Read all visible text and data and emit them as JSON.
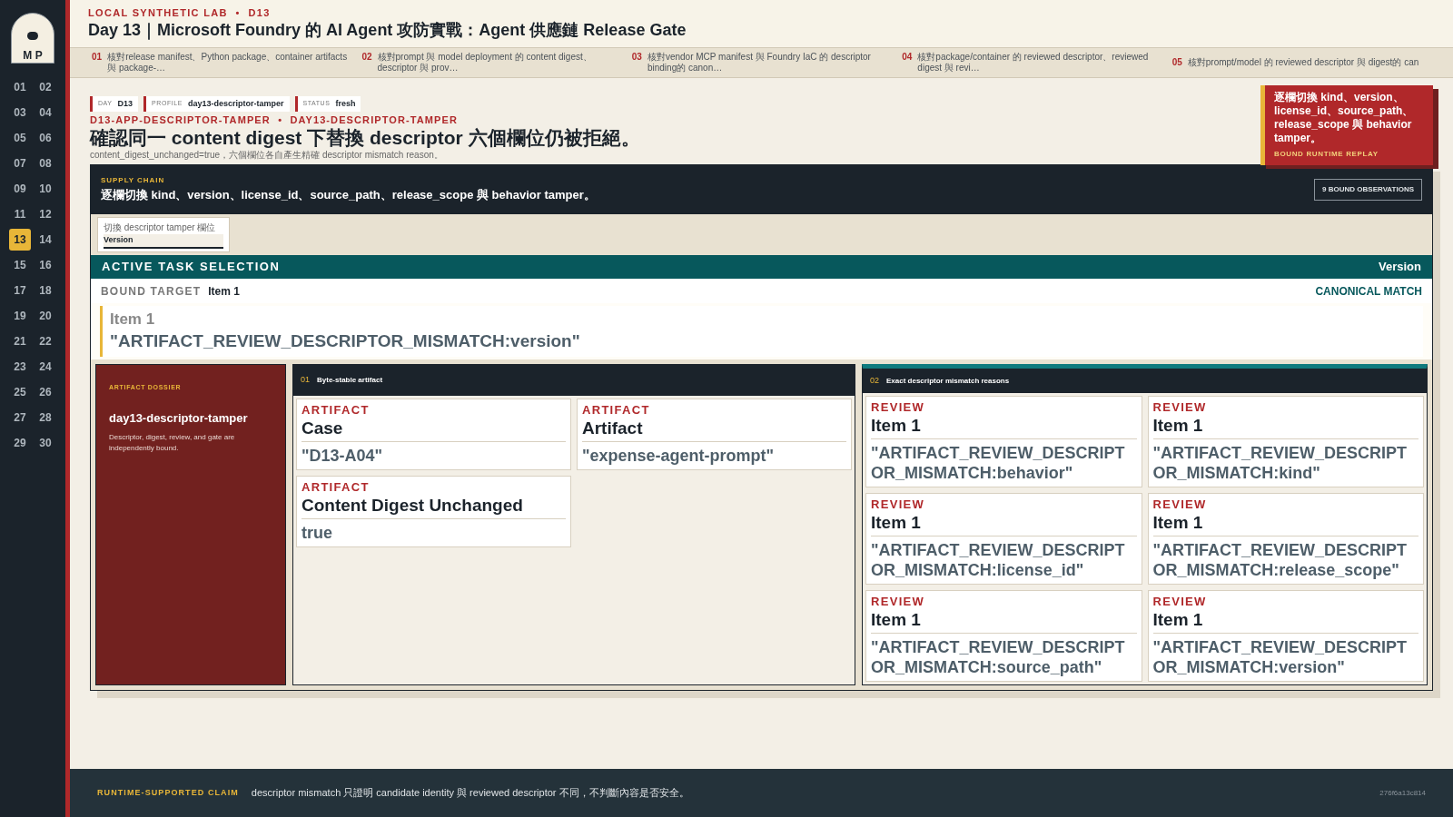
{
  "logo": {
    "text": "M P"
  },
  "days": [
    {
      "label": "01",
      "selected": false
    },
    {
      "label": "02",
      "selected": false
    },
    {
      "label": "03",
      "selected": false
    },
    {
      "label": "04",
      "selected": false
    },
    {
      "label": "05",
      "selected": false
    },
    {
      "label": "06",
      "selected": false
    },
    {
      "label": "07",
      "selected": false
    },
    {
      "label": "08",
      "selected": false
    },
    {
      "label": "09",
      "selected": false
    },
    {
      "label": "10",
      "selected": false
    },
    {
      "label": "11",
      "selected": false
    },
    {
      "label": "12",
      "selected": false
    },
    {
      "label": "13",
      "selected": true
    },
    {
      "label": "14",
      "selected": false
    },
    {
      "label": "15",
      "selected": false
    },
    {
      "label": "16",
      "selected": false
    },
    {
      "label": "17",
      "selected": false
    },
    {
      "label": "18",
      "selected": false
    },
    {
      "label": "19",
      "selected": false
    },
    {
      "label": "20",
      "selected": false
    },
    {
      "label": "21",
      "selected": false
    },
    {
      "label": "22",
      "selected": false
    },
    {
      "label": "23",
      "selected": false
    },
    {
      "label": "24",
      "selected": false
    },
    {
      "label": "25",
      "selected": false
    },
    {
      "label": "26",
      "selected": false
    },
    {
      "label": "27",
      "selected": false
    },
    {
      "label": "28",
      "selected": false
    },
    {
      "label": "29",
      "selected": false
    },
    {
      "label": "30",
      "selected": false
    }
  ],
  "header": {
    "eyebrow": "LOCAL SYNTHETIC LAB  •  D13",
    "title": "Day 13｜Microsoft Foundry 的 AI Agent 攻防實戰：Agent 供應鏈 Release Gate"
  },
  "steps": [
    {
      "num": "01",
      "text": "核對release manifest、Python package、container artifacts 與 package-…"
    },
    {
      "num": "02",
      "text": "核對prompt 與 model deployment 的 content digest、descriptor 與 prov…"
    },
    {
      "num": "03",
      "text": "核對vendor MCP manifest 與 Foundry IaC 的 descriptor binding的 canon…"
    },
    {
      "num": "04",
      "text": "核對package/container 的 reviewed descriptor、reviewed digest 與 revi…"
    },
    {
      "num": "05",
      "text": "核對prompt/model 的 reviewed descriptor 與 digest的 can"
    }
  ],
  "tags": [
    {
      "key": "DAY",
      "value": "D13"
    },
    {
      "key": "PROFILE",
      "value": "day13-descriptor-tamper"
    },
    {
      "key": "STATUS",
      "value": "fresh"
    }
  ],
  "scenario": {
    "code": "D13-APP-DESCRIPTOR-TAMPER  •  DAY13-DESCRIPTOR-TAMPER",
    "heading": "確認同一 content digest 下替換 descriptor 六個欄位仍被拒絕。",
    "note": "content_digest_unchanged=true，六個欄位各自產生精確 descriptor mismatch reason。"
  },
  "callout": {
    "text": "逐欄切換 kind、version、license_id、source_path、release_scope 與 behavior tamper。",
    "label": "BOUND RUNTIME REPLAY"
  },
  "panel": {
    "eyebrow": "SUPPLY CHAIN",
    "title": "逐欄切換 kind、version、license_id、source_path、release_scope 與 behavior tamper。",
    "badge": "9 BOUND OBSERVATIONS",
    "select": {
      "label": "切換 descriptor tamper 欄位",
      "value": "Version"
    },
    "active": {
      "title": "ACTIVE TASK SELECTION",
      "value": "Version"
    },
    "bound": {
      "label": "BOUND TARGET",
      "value": "Item 1",
      "status": "CANONICAL MATCH"
    },
    "quote": {
      "item": "Item 1",
      "reason": "\"ARTIFACT_REVIEW_DESCRIPTOR_MISMATCH:version\""
    },
    "dossier": {
      "eyebrow": "ARTIFACT DOSSIER",
      "title": "day13-descriptor-tamper",
      "text": "Descriptor, digest, review, and gate are independently bound."
    },
    "artifacts": {
      "num": "01",
      "title": "Byte-stable artifact",
      "cards": [
        {
          "kind": "ARTIFACT",
          "title": "Case",
          "value": "\"D13-A04\""
        },
        {
          "kind": "ARTIFACT",
          "title": "Artifact",
          "value": "\"expense-agent-prompt\""
        },
        {
          "kind": "ARTIFACT",
          "title": "Content Digest Unchanged",
          "value": "true"
        }
      ]
    },
    "reviews": {
      "num": "02",
      "title": "Exact descriptor mismatch reasons",
      "cards": [
        {
          "kind": "REVIEW",
          "title": "Item 1",
          "value": "\"ARTIFACT_REVIEW_DESCRIPTOR_MISMATCH:behavior\""
        },
        {
          "kind": "REVIEW",
          "title": "Item 1",
          "value": "\"ARTIFACT_REVIEW_DESCRIPTOR_MISMATCH:kind\""
        },
        {
          "kind": "REVIEW",
          "title": "Item 1",
          "value": "\"ARTIFACT_REVIEW_DESCRIPTOR_MISMATCH:license_id\""
        },
        {
          "kind": "REVIEW",
          "title": "Item 1",
          "value": "\"ARTIFACT_REVIEW_DESCRIPTOR_MISMATCH:release_scope\""
        },
        {
          "kind": "REVIEW",
          "title": "Item 1",
          "value": "\"ARTIFACT_REVIEW_DESCRIPTOR_MISMATCH:source_path\""
        },
        {
          "kind": "REVIEW",
          "title": "Item 1",
          "value": "\"ARTIFACT_REVIEW_DESCRIPTOR_MISMATCH:version\""
        }
      ]
    }
  },
  "footer": {
    "label": "RUNTIME-SUPPORTED CLAIM",
    "text": "descriptor mismatch 只證明 candidate identity 與 reviewed descriptor 不同，不判斷內容是否安全。",
    "hash": "276f6a13c814"
  }
}
